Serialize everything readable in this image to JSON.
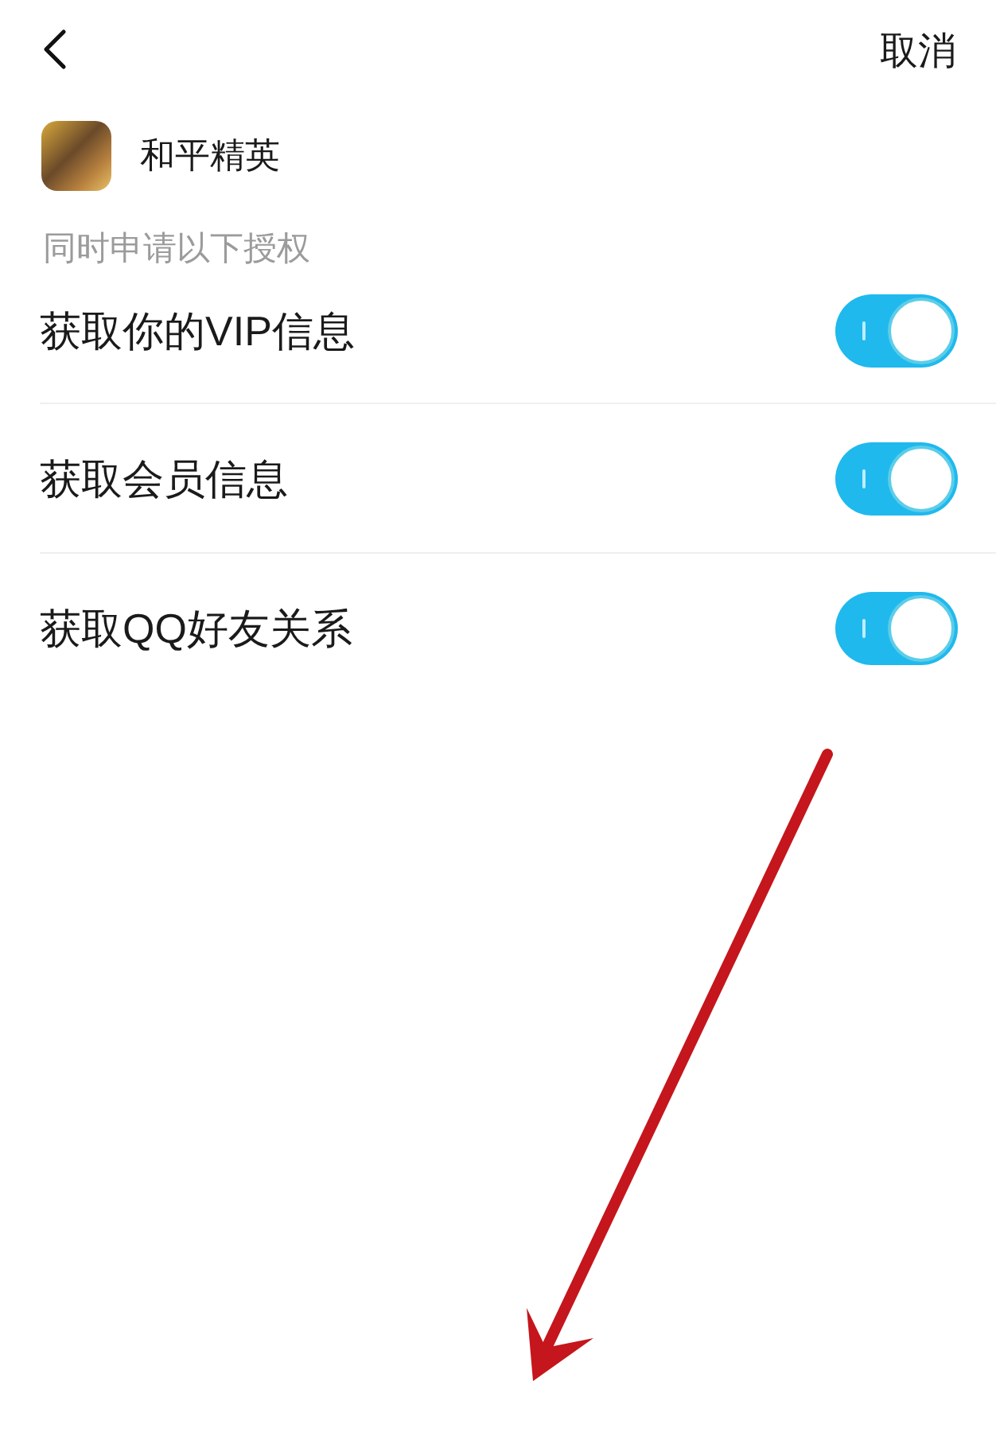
{
  "header": {
    "cancel": "取消"
  },
  "app": {
    "name": "和平精英"
  },
  "subtitle": "同时申请以下授权",
  "permissions": [
    {
      "label": "获取你的VIP信息",
      "on": true
    },
    {
      "label": "获取会员信息",
      "on": true
    },
    {
      "label": "获取QQ好友关系",
      "on": true
    }
  ]
}
